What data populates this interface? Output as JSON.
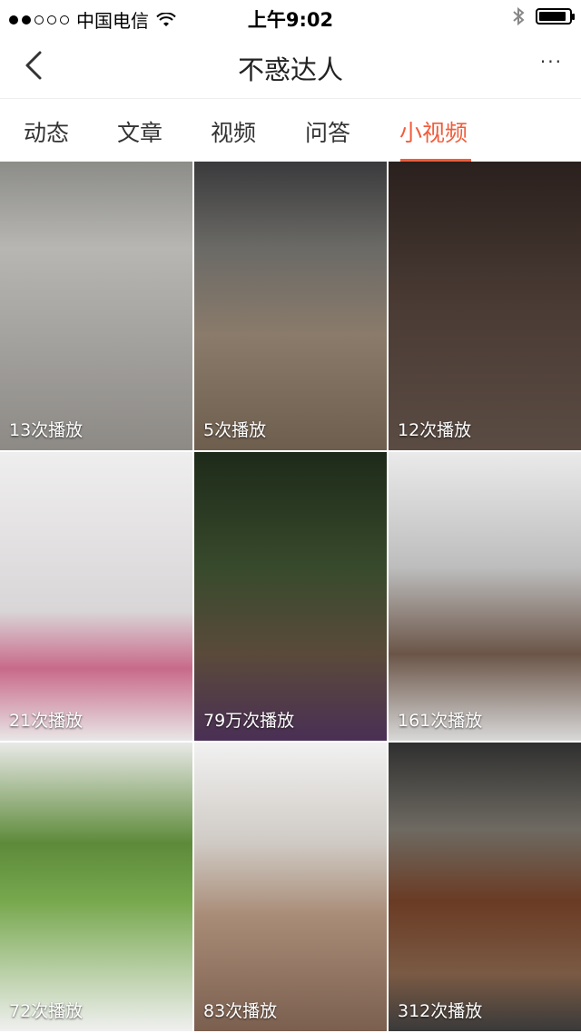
{
  "status_bar": {
    "carrier": "中国电信",
    "time": "上午9:02",
    "battery_percent": 90
  },
  "nav": {
    "title": "不惑达人",
    "more": "···"
  },
  "tabs": [
    {
      "label": "动态",
      "active": false
    },
    {
      "label": "文章",
      "active": false
    },
    {
      "label": "视频",
      "active": false
    },
    {
      "label": "问答",
      "active": false
    },
    {
      "label": "小视频",
      "active": true
    }
  ],
  "videos": [
    {
      "views": "13次播放"
    },
    {
      "views": "5次播放"
    },
    {
      "views": "12次播放"
    },
    {
      "views": "21次播放"
    },
    {
      "views": "79万次播放"
    },
    {
      "views": "161次播放"
    },
    {
      "views": "72次播放"
    },
    {
      "views": "83次播放"
    },
    {
      "views": "312次播放"
    }
  ],
  "colors": {
    "accent": "#f25c3a"
  }
}
